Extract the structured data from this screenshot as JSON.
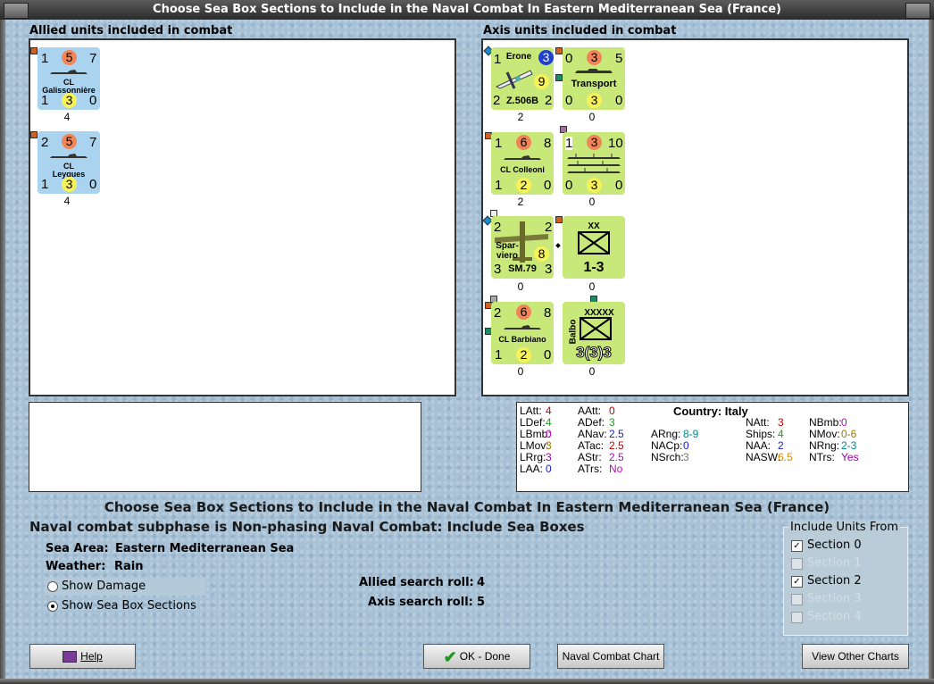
{
  "window": {
    "title": "Choose Sea Box Sections to Include in the Naval Combat In Eastern Mediterranean Sea (France)"
  },
  "allied": {
    "header": "Allied units included in combat",
    "units": [
      {
        "top_left": "1",
        "attack": "5",
        "top_right": "7",
        "type": "CL",
        "name": "Galissonnière",
        "bottom_left": "1",
        "defense": "3",
        "bottom_right": "0",
        "below": "4"
      },
      {
        "top_left": "2",
        "attack": "5",
        "top_right": "7",
        "type": "CL",
        "name": "Leygues",
        "bottom_left": "1",
        "defense": "3",
        "bottom_right": "0",
        "below": "4"
      }
    ]
  },
  "axis": {
    "header": "Axis units included in combat",
    "units": [
      {
        "top_left": "1",
        "name": "Erone",
        "range": "3",
        "value": "9",
        "bottom_left": "2",
        "label": "Z.506B",
        "bottom_right": "2",
        "below": "2"
      },
      {
        "top_left": "0",
        "attack": "3",
        "top_right": "5",
        "name": "Transport",
        "bottom_left": "0",
        "defense": "3",
        "bottom_right": "0",
        "below": "0"
      },
      {
        "top_left": "1",
        "attack": "6",
        "top_right": "8",
        "name": "CL Colleoni",
        "bottom_left": "1",
        "defense": "2",
        "bottom_right": "0",
        "below": "2"
      },
      {
        "top_left": "1",
        "attack": "3",
        "top_right": "10",
        "bottom_left": "0",
        "defense": "3",
        "bottom_right": "0",
        "below": "0"
      },
      {
        "top_left": "2",
        "name": "Spar-\nviero",
        "value": "8",
        "top_right": "2",
        "bottom_left": "3",
        "label": "SM.79",
        "bottom_right": "3",
        "below": "0"
      },
      {
        "size": "XX",
        "strength": "1-3",
        "below": "0"
      },
      {
        "top_left": "2",
        "attack": "6",
        "top_right": "8",
        "name": "CL Barbiano",
        "bottom_left": "1",
        "defense": "2",
        "bottom_right": "0",
        "below": "0"
      },
      {
        "size": "XXXXX",
        "name": "Balbo",
        "strength": "3(3)3",
        "below": "0"
      }
    ]
  },
  "stats": {
    "country_label": "Country: Italy",
    "col1": [
      [
        "LAtt:",
        "4",
        "#c00000"
      ],
      [
        "LDef:",
        "4",
        "#1a9a1a"
      ],
      [
        "LBmb:",
        "0",
        "#c000c0"
      ],
      [
        "LMov:",
        "3",
        "#9a7a00"
      ],
      [
        "LRrg:",
        "3",
        "#a000a0"
      ],
      [
        "LAA:",
        "0",
        "#1a1ad0"
      ]
    ],
    "col2": [
      [
        "AAtt:",
        "0",
        "#c00000"
      ],
      [
        "ADef:",
        "3",
        "#1a9a1a"
      ],
      [
        "ANav:",
        "2.5",
        "#1a1ad0"
      ],
      [
        "ATac:",
        "2.5",
        "#c00000"
      ],
      [
        "AStr:",
        "2.5",
        "#c000c0"
      ],
      [
        "ATrs:",
        "No",
        "#c000c0"
      ]
    ],
    "col3": [
      [
        "ARng:",
        "8-9",
        "#008a8a"
      ],
      [
        "NACp:",
        "0",
        "#1a1ad0"
      ],
      [
        "NSrch:",
        "3",
        "#7a7a7a"
      ]
    ],
    "col4": [
      [
        "NAtt:",
        "3",
        "#c00000"
      ],
      [
        "Ships:",
        "4",
        "#1a9a1a"
      ],
      [
        "NAA:",
        "2",
        "#1a1ad0"
      ],
      [
        "NASW:",
        "6.5",
        "#e08a00"
      ]
    ],
    "col5": [
      [
        "NBmb:",
        "0",
        "#c000c0"
      ],
      [
        "NMov:",
        "0-6",
        "#9a7a00"
      ],
      [
        "NRng:",
        "2-3",
        "#008a8a"
      ],
      [
        "NTrs:",
        "Yes",
        "#a000a0"
      ]
    ]
  },
  "main": {
    "heading": "Choose Sea Box Sections to Include in the Naval Combat In Eastern Mediterranean Sea (France)",
    "subheading": "Naval combat subphase is Non-phasing Naval Combat: Include Sea Boxes",
    "sea_area_label": "Sea Area:",
    "sea_area": "Eastern Mediterranean Sea",
    "weather_label": "Weather:",
    "weather": "Rain",
    "show_damage": "Show Damage",
    "show_sea_box": "Show Sea Box Sections",
    "allied_search_label": "Allied search roll:",
    "allied_search": "4",
    "axis_search_label": "Axis search roll:",
    "axis_search": "5"
  },
  "include": {
    "legend": "Include Units From",
    "sections": [
      {
        "label": "Section 0",
        "checked": true,
        "enabled": true
      },
      {
        "label": "Section 1",
        "checked": false,
        "enabled": false
      },
      {
        "label": "Section 2",
        "checked": true,
        "enabled": true
      },
      {
        "label": "Section 3",
        "checked": false,
        "enabled": false
      },
      {
        "label": "Section 4",
        "checked": false,
        "enabled": false
      }
    ]
  },
  "buttons": {
    "help": "Help",
    "ok": "OK - Done",
    "naval_chart": "Naval Combat Chart",
    "other_charts": "View Other Charts"
  },
  "colors": {
    "counter_green": "#c8e87a",
    "counter_blue": "#a9d3ef",
    "bg": "#a7c1d6"
  }
}
